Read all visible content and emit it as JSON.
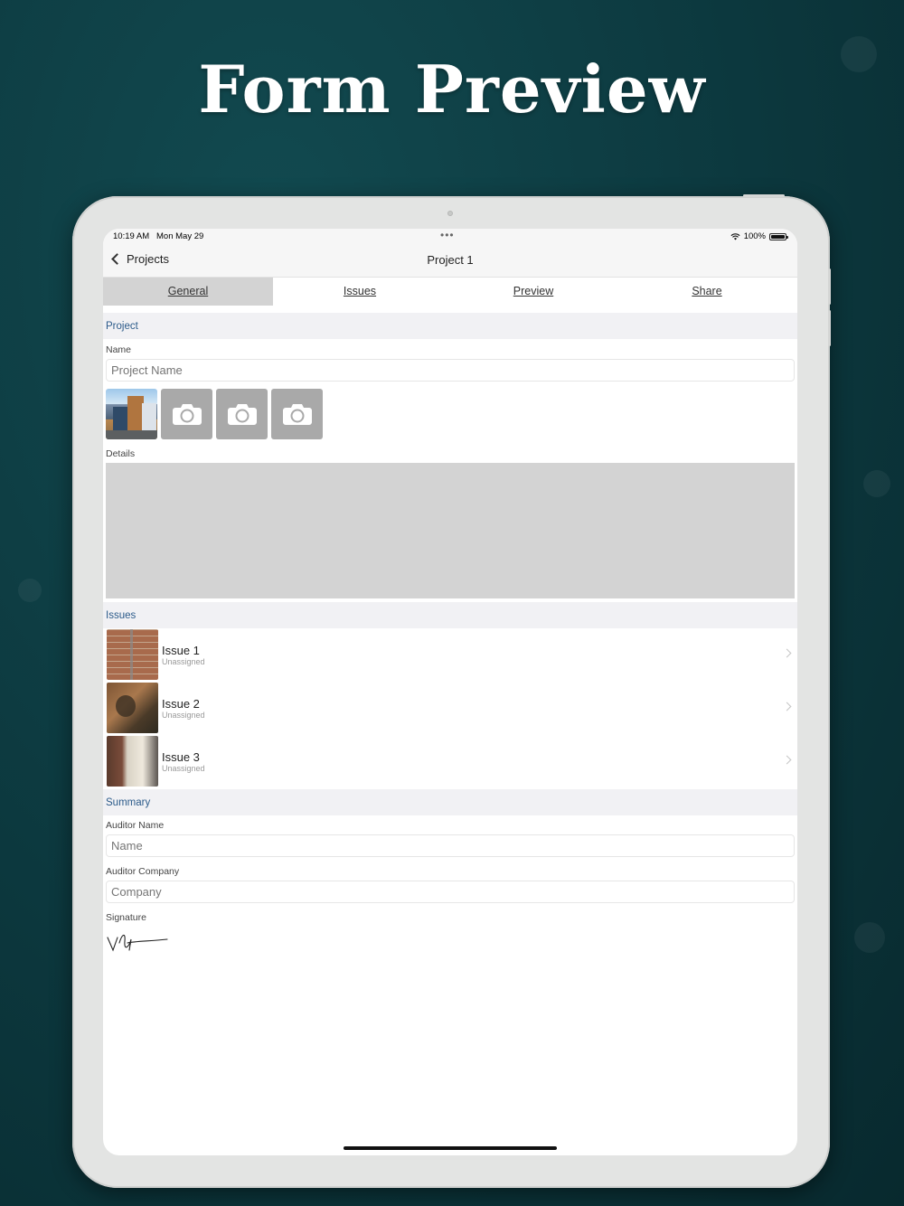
{
  "hero": {
    "title": "Form Preview"
  },
  "status_bar": {
    "time": "10:19 AM",
    "date": "Mon May 29",
    "dots": "•••",
    "battery": "100%"
  },
  "nav": {
    "back_label": "Projects",
    "title": "Project 1"
  },
  "tabs": [
    {
      "label": "General",
      "active": true
    },
    {
      "label": "Issues",
      "active": false
    },
    {
      "label": "Preview",
      "active": false
    },
    {
      "label": "Share",
      "active": false
    }
  ],
  "project_section": {
    "header": "Project",
    "name_label": "Name",
    "name_placeholder": "Project Name",
    "details_label": "Details"
  },
  "issues_section": {
    "header": "Issues",
    "items": [
      {
        "title": "Issue 1",
        "assignee": "Unassigned"
      },
      {
        "title": "Issue 2",
        "assignee": "Unassigned"
      },
      {
        "title": "Issue 3",
        "assignee": "Unassigned"
      }
    ]
  },
  "summary_section": {
    "header": "Summary",
    "auditor_name_label": "Auditor Name",
    "auditor_name_placeholder": "Name",
    "auditor_company_label": "Auditor Company",
    "auditor_company_placeholder": "Company",
    "signature_label": "Signature"
  },
  "colors": {
    "background": "#0d3b41",
    "section_header_text": "#2c5b8a",
    "active_tab": "#d3d3d3"
  }
}
